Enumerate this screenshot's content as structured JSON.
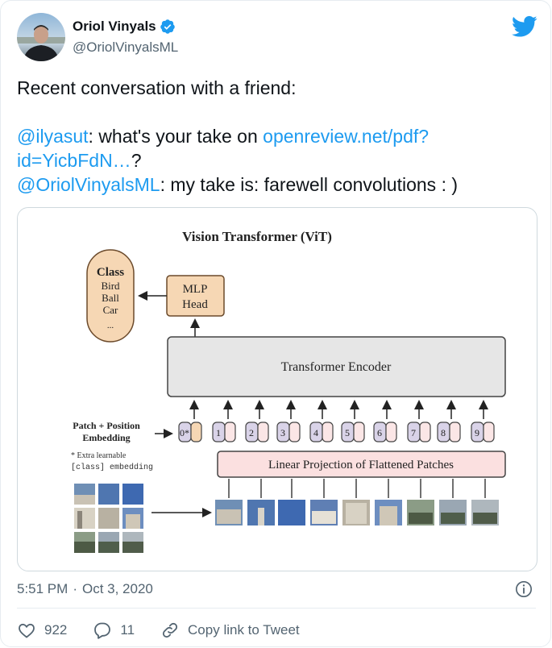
{
  "author": {
    "name": "Oriol Vinyals",
    "handle": "@OriolVinyalsML"
  },
  "tweet": {
    "line1": "Recent conversation with a friend:",
    "mention1": "@ilyasut",
    "text2a": ": what's your take on ",
    "link_text": "openreview.net/pdf?id=YicbFdN…",
    "text2b": "?",
    "mention2": "@OriolVinyalsML",
    "text3": ": my take is: farewell convolutions : )"
  },
  "diagram": {
    "title": "Vision Transformer (ViT)",
    "class_box": {
      "title": "Class",
      "items": [
        "Bird",
        "Ball",
        "Car",
        "..."
      ]
    },
    "mlp_head": [
      "MLP",
      "Head"
    ],
    "encoder": "Transformer Encoder",
    "projection": "Linear Projection of Flattened Patches",
    "embedding_label": [
      "Patch + Position",
      "Embedding"
    ],
    "extra_note": [
      "* Extra learnable",
      "[class] embedding"
    ],
    "tokens": [
      "0*",
      "1",
      "2",
      "3",
      "4",
      "5",
      "6",
      "7",
      "8",
      "9"
    ]
  },
  "meta": {
    "time": "5:51 PM",
    "separator": "·",
    "date": "Oct 3, 2020"
  },
  "actions": {
    "likes": "922",
    "replies": "11",
    "copy_link": "Copy link to Tweet"
  },
  "colors": {
    "accent": "#1d9bf0",
    "verified": "#1d9bf0",
    "text": "#0f1419",
    "muted": "#536471",
    "border": "#cfd9de"
  }
}
